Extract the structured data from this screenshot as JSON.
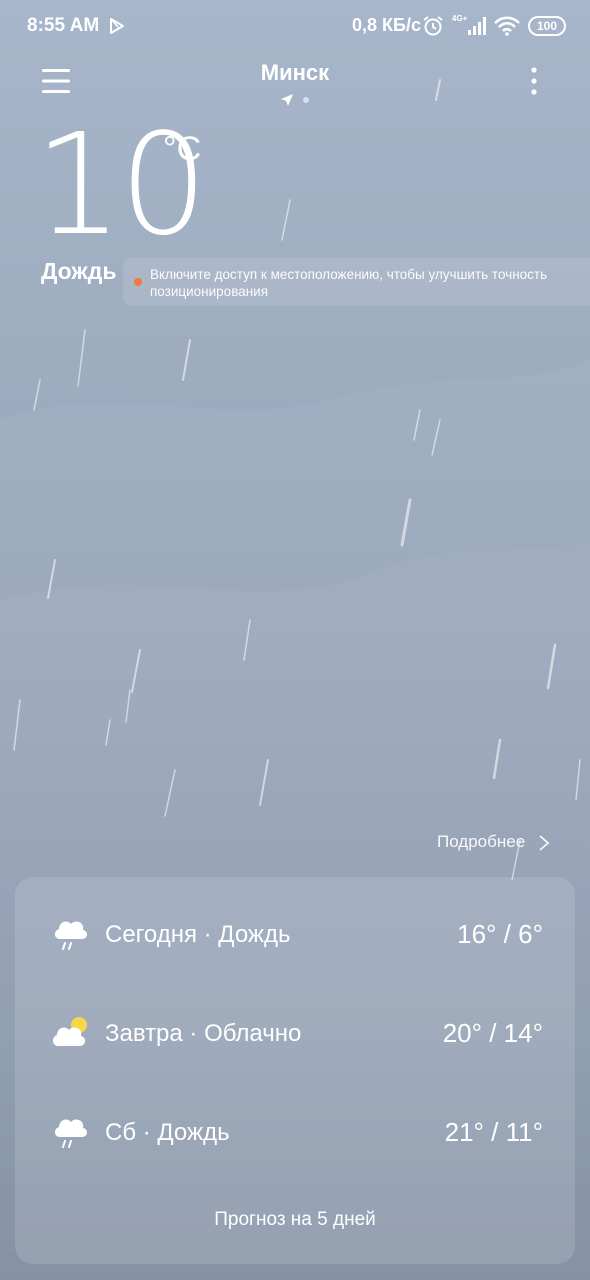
{
  "status_bar": {
    "time": "8:55 AM",
    "speed": "0,8 КБ/с",
    "network": "4G+",
    "battery": "100",
    "icons": [
      "play-store-icon",
      "alarm-icon",
      "signal-icon",
      "wifi-icon",
      "battery-icon"
    ]
  },
  "header": {
    "city": "Минск",
    "icons": [
      "menu-icon",
      "location-arrow-icon",
      "more-icon"
    ]
  },
  "current": {
    "temperature": "10",
    "unit": "°C",
    "condition": "Дождь"
  },
  "notice": {
    "text": "Включите доступ к местоположению, чтобы улучшить точность позиционирования",
    "dot_color": "#f07a3a"
  },
  "details_link": "Подробнее",
  "forecast": {
    "rows": [
      {
        "label": "Сегодня · Дождь",
        "temps": "16° / 6°",
        "icon": "rain-cloud-icon"
      },
      {
        "label": "Завтра · Облачно",
        "temps": "20° / 14°",
        "icon": "partly-cloudy-icon"
      },
      {
        "label": "Сб · Дождь",
        "temps": "21° / 11°",
        "icon": "rain-cloud-icon"
      }
    ],
    "five_day_label": "Прогноз на 5 дней"
  }
}
